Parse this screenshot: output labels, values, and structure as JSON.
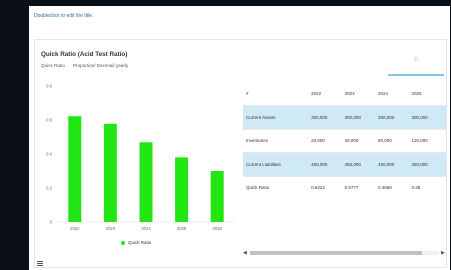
{
  "edit_title_hint": "Doubleclick to edit the title.",
  "widget": {
    "title": "Quick Ratio (Acid Test Ratio)",
    "subtitle_metric": "Quick Ratio",
    "subtitle_unit": "Proportion/ Decimal/ yearly",
    "toggle_label": "|||"
  },
  "chart_data": {
    "type": "bar",
    "categories": [
      "2022",
      "2023",
      "2024",
      "2025",
      "2026"
    ],
    "series": [
      {
        "name": "Quick Ratio",
        "values": [
          0.6222,
          0.5777,
          0.4688,
          0.38,
          0.3
        ],
        "color": "#22e614"
      }
    ],
    "yticks": [
      "0",
      "0.2",
      "0.4",
      "0.6",
      "0.8"
    ],
    "ylim": [
      0,
      0.8
    ],
    "grid": false,
    "legend": "bottom"
  },
  "table": {
    "headers": [
      "#",
      "2022",
      "2023",
      "2024",
      "2025"
    ],
    "rows": [
      {
        "label": "Current Assets",
        "values": [
          "300,000",
          "300,000",
          "300,000",
          "300,000"
        ],
        "highlight": true
      },
      {
        "label": "Inventories",
        "values": [
          "20,000",
          "40,000",
          "80,000",
          "120,000"
        ],
        "highlight": false
      },
      {
        "label": "Current Liabilities",
        "values": [
          "450,000",
          "450,000",
          "450,000",
          "450,000"
        ],
        "highlight": true
      },
      {
        "label": "Quick Ratio",
        "values": [
          "0.6222",
          "0.5777",
          "0.4688",
          "0.38"
        ],
        "highlight": false
      }
    ]
  },
  "scroll": {
    "left_arrow": "◀",
    "right_arrow": "▶"
  }
}
